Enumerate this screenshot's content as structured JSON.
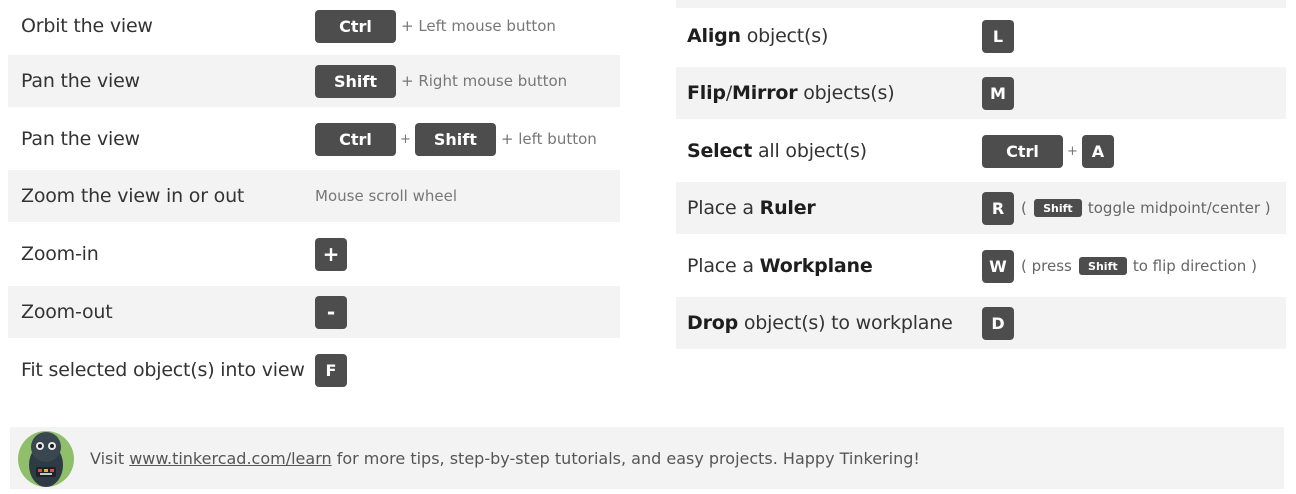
{
  "left": {
    "orbit": {
      "label": "Orbit the view",
      "key1": "Ctrl",
      "plus_text": "+ Left mouse button"
    },
    "pan1": {
      "label": "Pan the view",
      "key1": "Shift",
      "plus_text": "+ Right mouse button"
    },
    "pan2": {
      "label": "Pan the view",
      "key1": "Ctrl",
      "plus": "+",
      "key2": "Shift",
      "plus_text": "+ left button"
    },
    "zoom": {
      "label": "Zoom the view in or out",
      "desc": "Mouse scroll wheel"
    },
    "zoom_in": {
      "label": "Zoom-in",
      "key1": "+"
    },
    "zoom_out": {
      "label": "Zoom-out",
      "key1": "-"
    },
    "fit": {
      "label": "Fit selected object(s) into view",
      "key1": "F"
    }
  },
  "right": {
    "align": {
      "bold": "Align",
      "rest": " object(s)",
      "key1": "L"
    },
    "flip": {
      "bold1": "Flip",
      "sep": "/",
      "bold2": "Mirror",
      "rest": " objects(s)",
      "key1": "M"
    },
    "select": {
      "bold": "Select",
      "rest": " all object(s)",
      "key1": "Ctrl",
      "plus": "+",
      "key2": "A"
    },
    "ruler": {
      "pre": "Place a ",
      "bold": "Ruler",
      "key1": "R",
      "open": "(",
      "mini_key": "Shift",
      "note": "toggle midpoint/center )"
    },
    "workplane": {
      "pre": "Place a ",
      "bold": "Workplane",
      "key1": "W",
      "open": "( press",
      "mini_key": "Shift",
      "note": "to flip direction )"
    },
    "drop": {
      "bold": "Drop",
      "rest": " object(s) to workplane",
      "key1": "D"
    }
  },
  "footer": {
    "prefix": "Visit ",
    "link": "www.tinkercad.com/learn",
    "suffix": " for more tips, step-by-step tutorials, and easy projects. Happy Tinkering!"
  }
}
